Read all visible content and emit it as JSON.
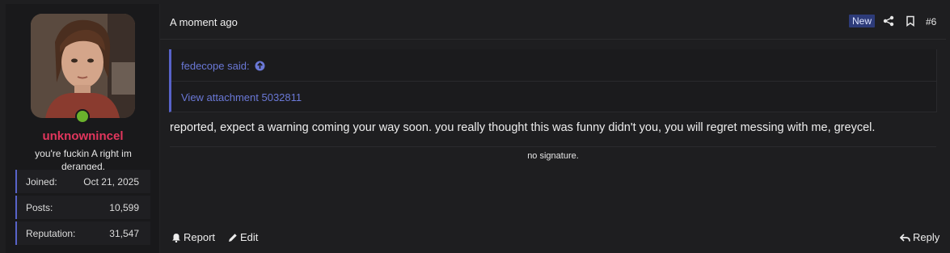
{
  "user": {
    "username": "unknownincel",
    "title": "you're fuckin A right im deranged.",
    "stats": [
      {
        "label": "Joined:",
        "value": "Oct 21, 2025"
      },
      {
        "label": "Posts:",
        "value": "10,599"
      },
      {
        "label": "Reputation:",
        "value": "31,547"
      }
    ]
  },
  "post": {
    "timestamp": "A moment ago",
    "badge": "New",
    "number": "#6",
    "quote": {
      "author": "fedecope said:",
      "attachment": "View attachment 5032811"
    },
    "message": "reported, expect a warning coming your way soon. you really thought this was funny didn't you, you will regret messing with me, greycel.",
    "signature": "no signature."
  },
  "actions": {
    "report": "Report",
    "edit": "Edit",
    "reply": "Reply"
  },
  "colors": {
    "username": "#e2365d",
    "accent": "#5863c9",
    "link": "#6a78d6",
    "online": "#6ab22c"
  }
}
